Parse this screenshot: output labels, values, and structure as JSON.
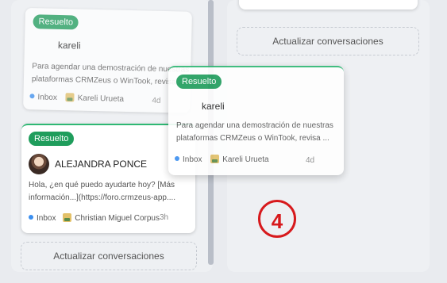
{
  "left_column": {
    "card_kareli": {
      "status": "Resuelto",
      "contact": "kareli",
      "message_line1": "Para agendar una demostración de nuestras",
      "message_line2": "plataformas CRMZeus o WinTook, revisa ...",
      "channel": "Inbox",
      "agent": "Kareli Urueta",
      "time": "4d"
    },
    "card_alejandra": {
      "status": "Resuelto",
      "contact": "ALEJANDRA PONCE",
      "message_line1": "Hola, ¿en qué puedo ayudarte hoy? [Más",
      "message_line2": "información...](https://foro.crmzeus-app....",
      "channel": "Inbox",
      "agent": "Christian Miguel Corpus",
      "time": "3h"
    },
    "refresh_label": "Actualizar conversaciones"
  },
  "right_column": {
    "refresh_label": "Actualizar conversaciones"
  },
  "dragging_card": {
    "status": "Resuelto",
    "contact": "kareli",
    "message_line1": "Para agendar una demostración de nuestras",
    "message_line2": "plataformas CRMZeus o WinTook, revisa ...",
    "channel": "Inbox",
    "agent": "Kareli Urueta",
    "time": "4d"
  },
  "annotation": {
    "step_number": "4"
  },
  "colors": {
    "status_green": "#1f9d5c",
    "inbox_dot": "#3b8ff0",
    "annotation_red": "#d7191c"
  }
}
